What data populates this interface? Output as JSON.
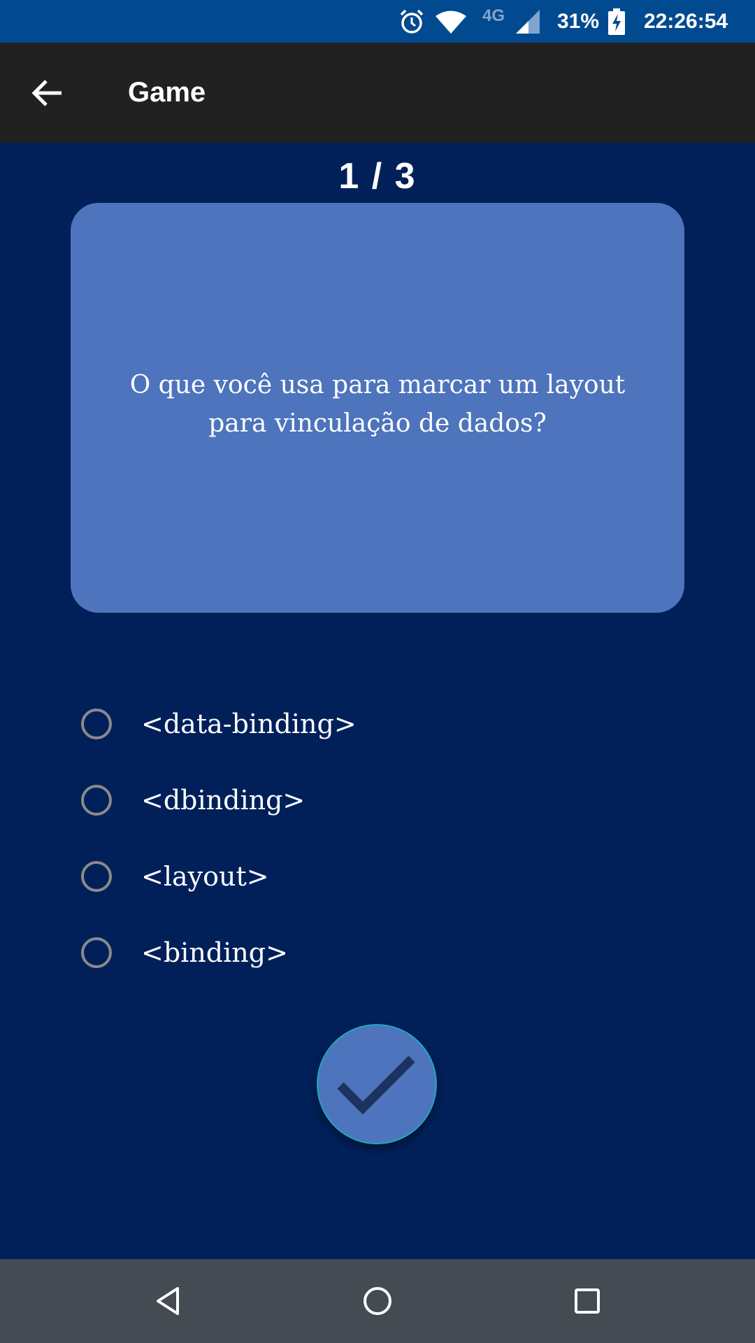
{
  "status_bar": {
    "network": "4G",
    "battery": "31%",
    "time": "22:26:54",
    "icons": [
      "alarm-icon",
      "wifi-icon",
      "signal-icon",
      "battery-charging-icon"
    ]
  },
  "app_bar": {
    "title": "Game",
    "back_icon": "arrow-left-icon"
  },
  "quiz": {
    "progress": "1 / 3",
    "question": "O que você usa para marcar um layout para vinculação de dados?",
    "options": [
      {
        "label": "<data-binding>",
        "selected": false
      },
      {
        "label": "<dbinding>",
        "selected": false
      },
      {
        "label": "<layout>",
        "selected": false
      },
      {
        "label": "<binding>",
        "selected": false
      }
    ],
    "submit_icon": "check-icon"
  },
  "nav_bar": {
    "icons": [
      "back-triangle-icon",
      "home-circle-icon",
      "recents-square-icon"
    ]
  },
  "colors": {
    "background": "#012059",
    "card": "#4D74BC",
    "status_bar": "#014A8F",
    "app_bar": "#212121",
    "nav_bar": "#454B53"
  }
}
